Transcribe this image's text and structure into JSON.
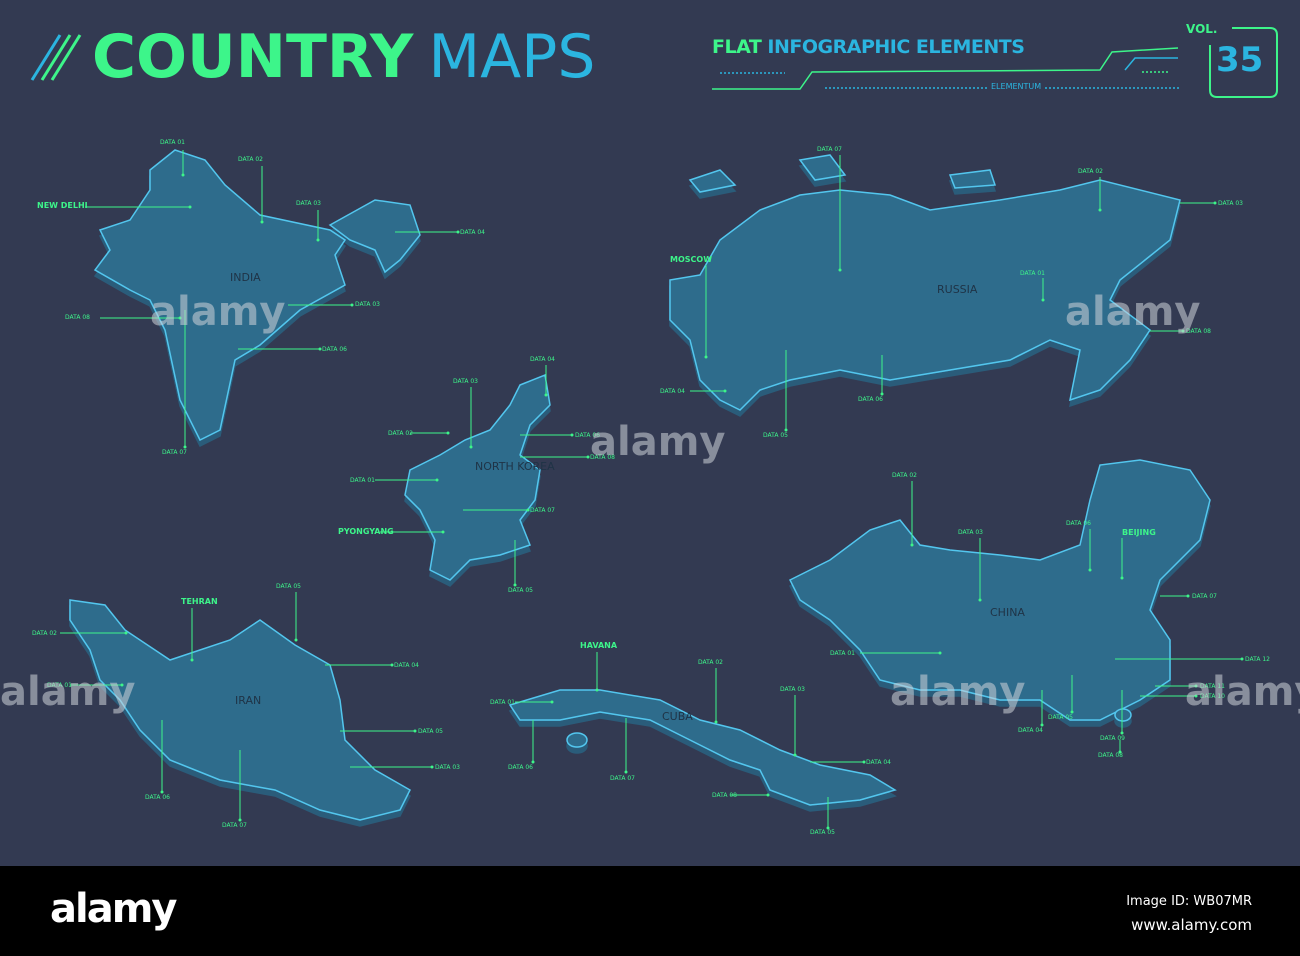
{
  "header": {
    "title_part1": "COUNTRY",
    "title_part2": "MAPS",
    "subtitle_part1": "FLAT",
    "subtitle_part2": "INFOGRAPHIC ELEMENTS",
    "brand": "ELEMENTUM",
    "vol_label": "VOL.",
    "vol_number": "35"
  },
  "colors": {
    "background": "#333a52",
    "map_fill": "#2f6c8c",
    "map_outline": "#52c6ee",
    "green": "#3df58a",
    "blue": "#2bb5e0"
  },
  "maps": [
    {
      "name": "INDIA",
      "labels": [
        "DATA 01",
        "DATA 02",
        "NEW DELHI",
        "DATA 03",
        "DATA 04",
        "DATA 03",
        "DATA 08",
        "DATA 06",
        "DATA 07"
      ]
    },
    {
      "name": "RUSSIA",
      "labels": [
        "DATA 07",
        "DATA 02",
        "DATA 03",
        "MOSCOW",
        "DATA 01",
        "DATA 08",
        "DATA 04",
        "DATA 06",
        "DATA 05"
      ]
    },
    {
      "name": "NORTH KOREA",
      "labels": [
        "DATA 04",
        "DATA 03",
        "DATA 02",
        "DATA 06",
        "DATA 08",
        "DATA 01",
        "DATA 07",
        "PYONGYANG",
        "DATA 05"
      ]
    },
    {
      "name": "IRAN",
      "labels": [
        "TEHRAN",
        "DATA 05",
        "DATA 02",
        "DATA 04",
        "DATA 01",
        "DATA 05",
        "DATA 03",
        "DATA 06",
        "DATA 07"
      ]
    },
    {
      "name": "CUBA",
      "labels": [
        "HAVANA",
        "DATA 02",
        "DATA 01",
        "DATA 03",
        "DATA 06",
        "DATA 07",
        "DATA 04",
        "DATA 08",
        "DATA 05"
      ]
    },
    {
      "name": "CHINA",
      "labels": [
        "DATA 02",
        "DATA 03",
        "DATA 06",
        "BEIJING",
        "DATA 07",
        "DATA 01",
        "DATA 12",
        "DATA 11",
        "DATA 10",
        "DATA 04",
        "DATA 05",
        "DATA 09",
        "DATA 08"
      ]
    }
  ],
  "watermark": {
    "text": "alamy"
  },
  "footer": {
    "logo": "alamy",
    "image_id": "Image ID: WB07MR",
    "url": "www.alamy.com"
  }
}
